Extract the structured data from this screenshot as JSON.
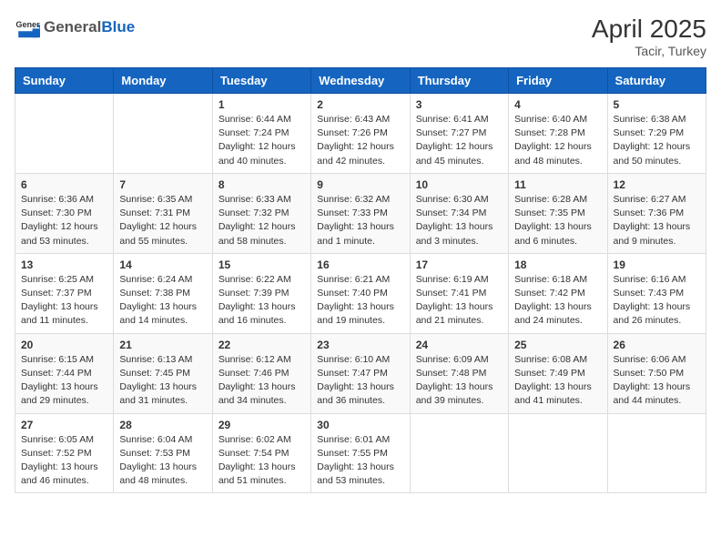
{
  "header": {
    "logo_general": "General",
    "logo_blue": "Blue",
    "month": "April 2025",
    "location": "Tacir, Turkey"
  },
  "days_of_week": [
    "Sunday",
    "Monday",
    "Tuesday",
    "Wednesday",
    "Thursday",
    "Friday",
    "Saturday"
  ],
  "weeks": [
    [
      {
        "day": "",
        "info": ""
      },
      {
        "day": "",
        "info": ""
      },
      {
        "day": "1",
        "info": "Sunrise: 6:44 AM\nSunset: 7:24 PM\nDaylight: 12 hours and 40 minutes."
      },
      {
        "day": "2",
        "info": "Sunrise: 6:43 AM\nSunset: 7:26 PM\nDaylight: 12 hours and 42 minutes."
      },
      {
        "day": "3",
        "info": "Sunrise: 6:41 AM\nSunset: 7:27 PM\nDaylight: 12 hours and 45 minutes."
      },
      {
        "day": "4",
        "info": "Sunrise: 6:40 AM\nSunset: 7:28 PM\nDaylight: 12 hours and 48 minutes."
      },
      {
        "day": "5",
        "info": "Sunrise: 6:38 AM\nSunset: 7:29 PM\nDaylight: 12 hours and 50 minutes."
      }
    ],
    [
      {
        "day": "6",
        "info": "Sunrise: 6:36 AM\nSunset: 7:30 PM\nDaylight: 12 hours and 53 minutes."
      },
      {
        "day": "7",
        "info": "Sunrise: 6:35 AM\nSunset: 7:31 PM\nDaylight: 12 hours and 55 minutes."
      },
      {
        "day": "8",
        "info": "Sunrise: 6:33 AM\nSunset: 7:32 PM\nDaylight: 12 hours and 58 minutes."
      },
      {
        "day": "9",
        "info": "Sunrise: 6:32 AM\nSunset: 7:33 PM\nDaylight: 13 hours and 1 minute."
      },
      {
        "day": "10",
        "info": "Sunrise: 6:30 AM\nSunset: 7:34 PM\nDaylight: 13 hours and 3 minutes."
      },
      {
        "day": "11",
        "info": "Sunrise: 6:28 AM\nSunset: 7:35 PM\nDaylight: 13 hours and 6 minutes."
      },
      {
        "day": "12",
        "info": "Sunrise: 6:27 AM\nSunset: 7:36 PM\nDaylight: 13 hours and 9 minutes."
      }
    ],
    [
      {
        "day": "13",
        "info": "Sunrise: 6:25 AM\nSunset: 7:37 PM\nDaylight: 13 hours and 11 minutes."
      },
      {
        "day": "14",
        "info": "Sunrise: 6:24 AM\nSunset: 7:38 PM\nDaylight: 13 hours and 14 minutes."
      },
      {
        "day": "15",
        "info": "Sunrise: 6:22 AM\nSunset: 7:39 PM\nDaylight: 13 hours and 16 minutes."
      },
      {
        "day": "16",
        "info": "Sunrise: 6:21 AM\nSunset: 7:40 PM\nDaylight: 13 hours and 19 minutes."
      },
      {
        "day": "17",
        "info": "Sunrise: 6:19 AM\nSunset: 7:41 PM\nDaylight: 13 hours and 21 minutes."
      },
      {
        "day": "18",
        "info": "Sunrise: 6:18 AM\nSunset: 7:42 PM\nDaylight: 13 hours and 24 minutes."
      },
      {
        "day": "19",
        "info": "Sunrise: 6:16 AM\nSunset: 7:43 PM\nDaylight: 13 hours and 26 minutes."
      }
    ],
    [
      {
        "day": "20",
        "info": "Sunrise: 6:15 AM\nSunset: 7:44 PM\nDaylight: 13 hours and 29 minutes."
      },
      {
        "day": "21",
        "info": "Sunrise: 6:13 AM\nSunset: 7:45 PM\nDaylight: 13 hours and 31 minutes."
      },
      {
        "day": "22",
        "info": "Sunrise: 6:12 AM\nSunset: 7:46 PM\nDaylight: 13 hours and 34 minutes."
      },
      {
        "day": "23",
        "info": "Sunrise: 6:10 AM\nSunset: 7:47 PM\nDaylight: 13 hours and 36 minutes."
      },
      {
        "day": "24",
        "info": "Sunrise: 6:09 AM\nSunset: 7:48 PM\nDaylight: 13 hours and 39 minutes."
      },
      {
        "day": "25",
        "info": "Sunrise: 6:08 AM\nSunset: 7:49 PM\nDaylight: 13 hours and 41 minutes."
      },
      {
        "day": "26",
        "info": "Sunrise: 6:06 AM\nSunset: 7:50 PM\nDaylight: 13 hours and 44 minutes."
      }
    ],
    [
      {
        "day": "27",
        "info": "Sunrise: 6:05 AM\nSunset: 7:52 PM\nDaylight: 13 hours and 46 minutes."
      },
      {
        "day": "28",
        "info": "Sunrise: 6:04 AM\nSunset: 7:53 PM\nDaylight: 13 hours and 48 minutes."
      },
      {
        "day": "29",
        "info": "Sunrise: 6:02 AM\nSunset: 7:54 PM\nDaylight: 13 hours and 51 minutes."
      },
      {
        "day": "30",
        "info": "Sunrise: 6:01 AM\nSunset: 7:55 PM\nDaylight: 13 hours and 53 minutes."
      },
      {
        "day": "",
        "info": ""
      },
      {
        "day": "",
        "info": ""
      },
      {
        "day": "",
        "info": ""
      }
    ]
  ]
}
